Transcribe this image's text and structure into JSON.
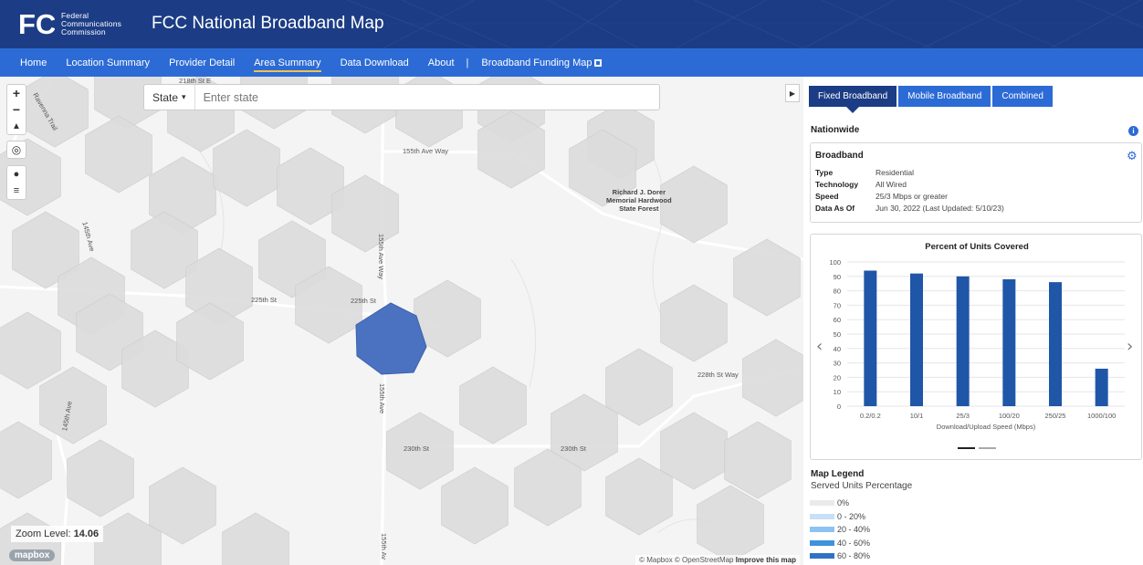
{
  "header": {
    "agency_line1": "Federal",
    "agency_line2": "Communications",
    "agency_line3": "Commission",
    "title": "FCC National Broadband Map"
  },
  "nav": {
    "items": [
      {
        "label": "Home"
      },
      {
        "label": "Location Summary"
      },
      {
        "label": "Provider Detail"
      },
      {
        "label": "Area Summary"
      },
      {
        "label": "Data Download"
      },
      {
        "label": "About"
      }
    ],
    "separator": "|",
    "funding": "Broadband Funding Map",
    "active": "Area Summary"
  },
  "map": {
    "search": {
      "dropdown_label": "State",
      "dropdown_caret": "▾",
      "placeholder": "Enter state"
    },
    "zoom_label": "Zoom Level:",
    "zoom_value": "14.06",
    "mapbox_logo": "mapbox",
    "attribution": "© Mapbox © OpenStreetMap",
    "improve": "Improve this map",
    "labels": {
      "forest": [
        "Richard J. Dorer",
        "Memorial Hardwood",
        "State Forest"
      ],
      "st_155ave_way": "155th Ave Way",
      "st_155ave_way_v": "155th Ave Way",
      "st_225_1": "225th St",
      "st_225_2": "225th St",
      "st_228_way": "228th St Way",
      "st_230_1": "230th St",
      "st_230_2": "230th St",
      "st_155ave_v1": "155th Ave",
      "st_155ave_v2": "155th Av",
      "st_145_1": "145th Ave",
      "st_145_2": "145th Ave",
      "st_ravenna": "Ravenna Trail",
      "st_218": "218th St E"
    }
  },
  "panel": {
    "tabs": [
      {
        "label": "Fixed Broadband"
      },
      {
        "label": "Mobile Broadband"
      },
      {
        "label": "Combined"
      }
    ],
    "active_tab": "Fixed Broadband",
    "scope": "Nationwide",
    "broadband": {
      "title": "Broadband",
      "rows": [
        {
          "key": "Type",
          "value": "Residential"
        },
        {
          "key": "Technology",
          "value": "All Wired"
        },
        {
          "key": "Speed",
          "value": "25/3 Mbps or greater"
        },
        {
          "key": "Data As Of",
          "value": "Jun 30, 2022 (Last Updated: 5/10/23)"
        }
      ]
    },
    "legend": {
      "title": "Map Legend",
      "subtitle": "Served Units Percentage",
      "items": [
        {
          "label": "0%",
          "color": "#eaeaea"
        },
        {
          "label": "0 - 20%",
          "color": "#c6e0f7"
        },
        {
          "label": "20 - 40%",
          "color": "#8cc3f0"
        },
        {
          "label": "40 - 60%",
          "color": "#3f93dd"
        },
        {
          "label": "60 - 80%",
          "color": "#2f72c4"
        }
      ]
    }
  },
  "chart_data": {
    "type": "bar",
    "title": "Percent of Units Covered",
    "xlabel": "Download/Upload Speed (Mbps)",
    "ylabel": "",
    "categories": [
      "0.2/0.2",
      "10/1",
      "25/3",
      "100/20",
      "250/25",
      "1000/100"
    ],
    "values": [
      94,
      92,
      90,
      88,
      86,
      26
    ],
    "ylim": [
      0,
      100
    ],
    "yticks": [
      0,
      10,
      20,
      30,
      40,
      50,
      60,
      70,
      80,
      90,
      100
    ],
    "grid": true,
    "bar_color": "#1f56a8"
  },
  "colors": {
    "header_bg": "#1c3d85",
    "nav_bg": "#2c6bd5",
    "selected_hex": "#4a72c0",
    "hex_gray": "#dcdcdc"
  }
}
